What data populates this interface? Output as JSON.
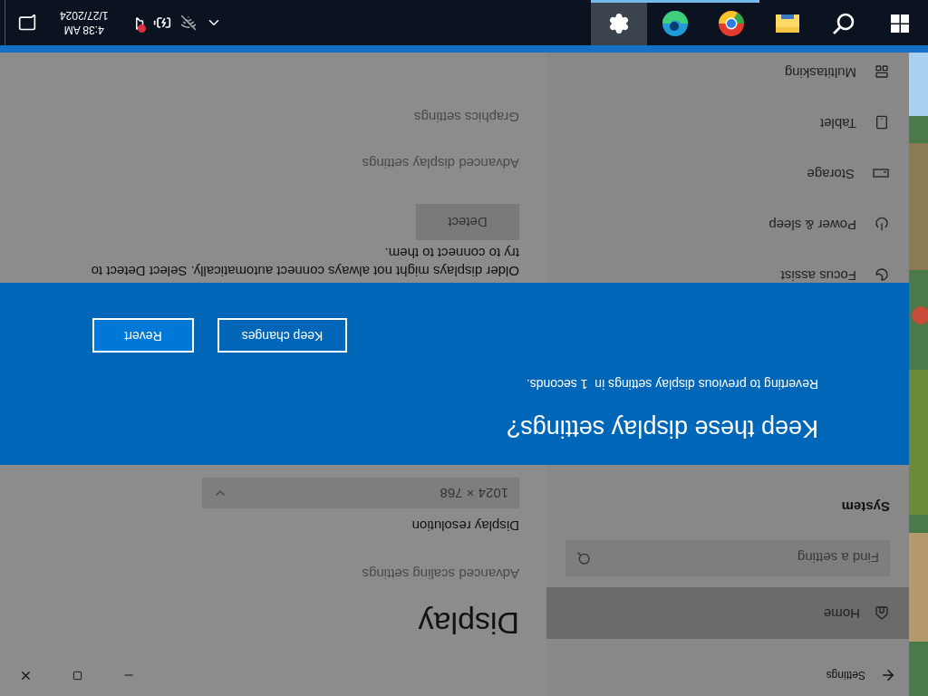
{
  "window": {
    "title": "Settings"
  },
  "sidebar": {
    "home": {
      "label": "Home",
      "selected": true
    },
    "search": {
      "placeholder": "Find a setting"
    },
    "section": "System",
    "items": [
      {
        "label": "Focus assist",
        "selected": false
      },
      {
        "label": "Power & sleep",
        "selected": false
      },
      {
        "label": "Storage",
        "selected": false
      },
      {
        "label": "Tablet",
        "selected": false
      },
      {
        "label": "Multitasking",
        "selected": false
      }
    ]
  },
  "main": {
    "title": "Display",
    "scaling_link": "Advanced scaling settings",
    "resolution_label": "Display resolution",
    "resolution_value": "1024 × 768",
    "detect_text": "Older displays might not always connect automatically. Select Detect to try to connect to them.",
    "detect_button": "Detect",
    "links": [
      "Advanced display settings",
      "Graphics settings"
    ]
  },
  "dialog": {
    "title": "Keep these display settings?",
    "message": "Reverting to previous display settings in  1 seconds.",
    "buttons": [
      {
        "label": "Keep changes",
        "kind": "secondary"
      },
      {
        "label": "Revert",
        "kind": "primary"
      }
    ]
  },
  "taskbar": {
    "apps": [
      {
        "running": false,
        "selected": false
      },
      {
        "running": false,
        "selected": false
      },
      {
        "running": false,
        "selected": false
      },
      {
        "running": true,
        "selected": false
      },
      {
        "running": true,
        "selected": false
      },
      {
        "running": true,
        "selected": true
      }
    ],
    "time": "4:38 AM",
    "date": "1/27/2024",
    "volume_muted": true
  }
}
